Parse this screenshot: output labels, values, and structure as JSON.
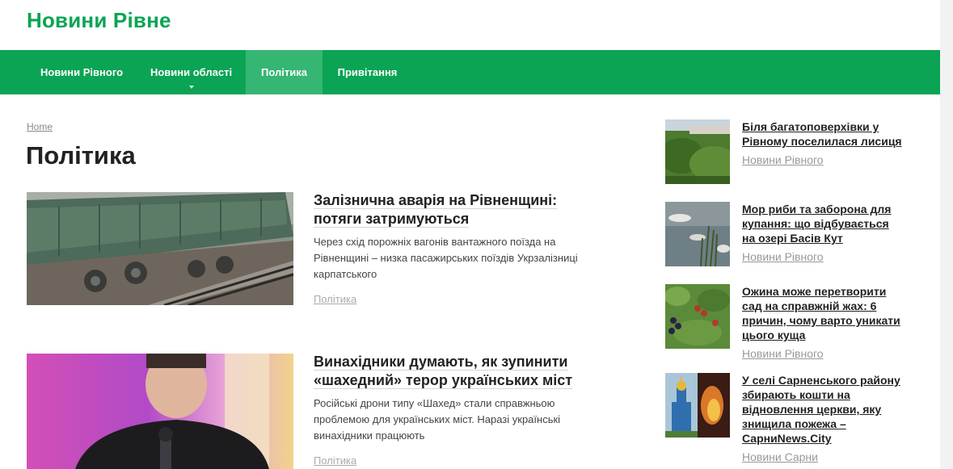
{
  "site": {
    "logo": "Новини Рівне"
  },
  "nav": {
    "items": [
      {
        "label": "Новини Рівного"
      },
      {
        "label": "Новини області"
      },
      {
        "label": "Політика"
      },
      {
        "label": "Привітання"
      }
    ],
    "active": "Політика",
    "color": "#0aa454"
  },
  "breadcrumb": {
    "home": "Home"
  },
  "page": {
    "title": "Політика"
  },
  "posts": [
    {
      "title_line1": "Залізнична аварія на Рівненщині:",
      "title_line2": "потяги затримуються",
      "excerpt_line1": "Через схід порожніх вагонів вантажного поїзда на",
      "excerpt_line2": "Рівненщині – низка пасажирських поїздів Укрзалізниці",
      "excerpt_line3": "карпатського",
      "category": "Політика",
      "image": "derailed-freight-wagon-photo"
    },
    {
      "title_line1": "Винахідники думають, як зупинити",
      "title_line2": "«шахедний» терор українських міст",
      "excerpt_line1": "Російські дрони типу «Шахед» стали справжньою",
      "excerpt_line2": "проблемою для українських міст.  Наразі українські",
      "excerpt_line3": "винахідники працюють",
      "category": "Політика",
      "image": "speaker-with-microphone-photo"
    }
  ],
  "sidebar": [
    {
      "title_lines": [
        "Біля багатоповерхівки у",
        "Рівному поселилася лисиця"
      ],
      "category": "Новини Рівного",
      "image": "green-landscape-photo"
    },
    {
      "title_lines": [
        "Мор риби та заборона для",
        "купання: що відбувається",
        "на озері Басів Кут"
      ],
      "category": "Новини Рівного",
      "image": "dead-fish-lake-photo"
    },
    {
      "title_lines": [
        "Ожина може перетворити",
        "сад на справжній жах: 6",
        "причин, чому варто уникати",
        "цього куща"
      ],
      "category": "Новини Рівного",
      "image": "blackberry-bush-photo"
    },
    {
      "title_lines": [
        "У селі Сарненського району",
        "збирають кошти на",
        "відновлення церкви, яку",
        "знищила пожежа –",
        "СарниNews.City"
      ],
      "category": "Новини Сарни",
      "image": "church-fire-photo"
    }
  ]
}
